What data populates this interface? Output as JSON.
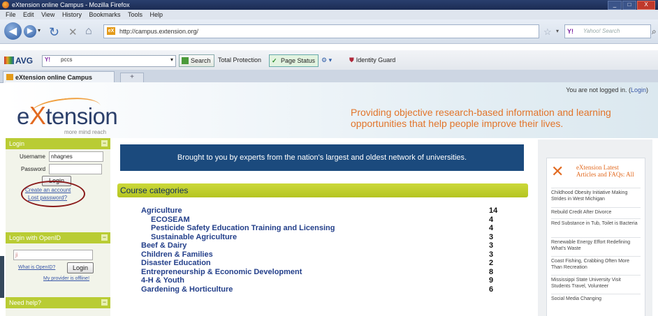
{
  "window": {
    "title": "eXtension online Campus - Mozilla Firefox",
    "controls": [
      "_",
      "□",
      "X"
    ]
  },
  "menu": [
    "File",
    "Edit",
    "View",
    "History",
    "Bookmarks",
    "Tools",
    "Help"
  ],
  "navbar": {
    "url": "http://campus.extension.org/",
    "search_placeholder": "Yahoo! Search",
    "search_engine": "Y!"
  },
  "avg_toolbar": {
    "logo": "AVG",
    "search_engine": "Y!",
    "search_value": "pccs",
    "search_button": "Search",
    "total_protection": "Total Protection",
    "page_status": "Page Status",
    "identity_guard": "Identity Guard"
  },
  "tabs": {
    "active": "eXtension online Campus",
    "new_tab": "+"
  },
  "header": {
    "login_status_prefix": "You are not logged in. (",
    "login_link": "Login",
    "login_status_suffix": ")",
    "logo_word": "tension",
    "logo_letters": [
      "e",
      "X"
    ],
    "logo_tagline": "more mind reach",
    "tagline": "Providing objective research-based information and learning opportunities that help people improve their lives."
  },
  "sidebar": {
    "login_title": "Login",
    "username_label": "Username",
    "username_value": "nhagnes",
    "password_label": "Password",
    "login_button": "Login",
    "create_account": "Create an account",
    "lost_password": "Lost password?",
    "openid_title": "Login with OpenID",
    "openid_value": "ji",
    "what_is_openid": "What is OpenID?",
    "openid_login_button": "Login",
    "provider_offline": "My provider is offline!",
    "help_title": "Need help?"
  },
  "banner": "Brought to you by experts from the nation's largest and oldest network of universities.",
  "course_categories": {
    "title": "Course categories",
    "items": [
      {
        "name": "Agriculture",
        "count": "14",
        "sub": false
      },
      {
        "name": "ECOSEAM",
        "count": "4",
        "sub": true
      },
      {
        "name": "Pesticide Safety Education Training and Licensing",
        "count": "4",
        "sub": true
      },
      {
        "name": "Sustainable Agriculture",
        "count": "3",
        "sub": true
      },
      {
        "name": "Beef & Dairy",
        "count": "3",
        "sub": false
      },
      {
        "name": "Children & Families",
        "count": "3",
        "sub": false
      },
      {
        "name": "Disaster Education",
        "count": "2",
        "sub": false
      },
      {
        "name": "Entrepreneurship & Economic Development",
        "count": "8",
        "sub": false
      },
      {
        "name": "4-H & Youth",
        "count": "9",
        "sub": false
      },
      {
        "name": "Gardening & Horticulture",
        "count": "6",
        "sub": false
      }
    ]
  },
  "feed": {
    "title": "eXtension Latest Articles and FAQs: All",
    "items": [
      "Childhood Obesity Initiative Making Strides in West Michigan",
      "Rebuild Credit After Divorce",
      "Red Substance in Tub, Toilet is Bacteria",
      "Renewable Energy Effort Redefining What's Waste",
      "Coast Fishing, Crabbing Often More Than Recreation",
      "Mississippi State University Visit Students Travel, Volunteer",
      "Social Media Changing"
    ]
  }
}
